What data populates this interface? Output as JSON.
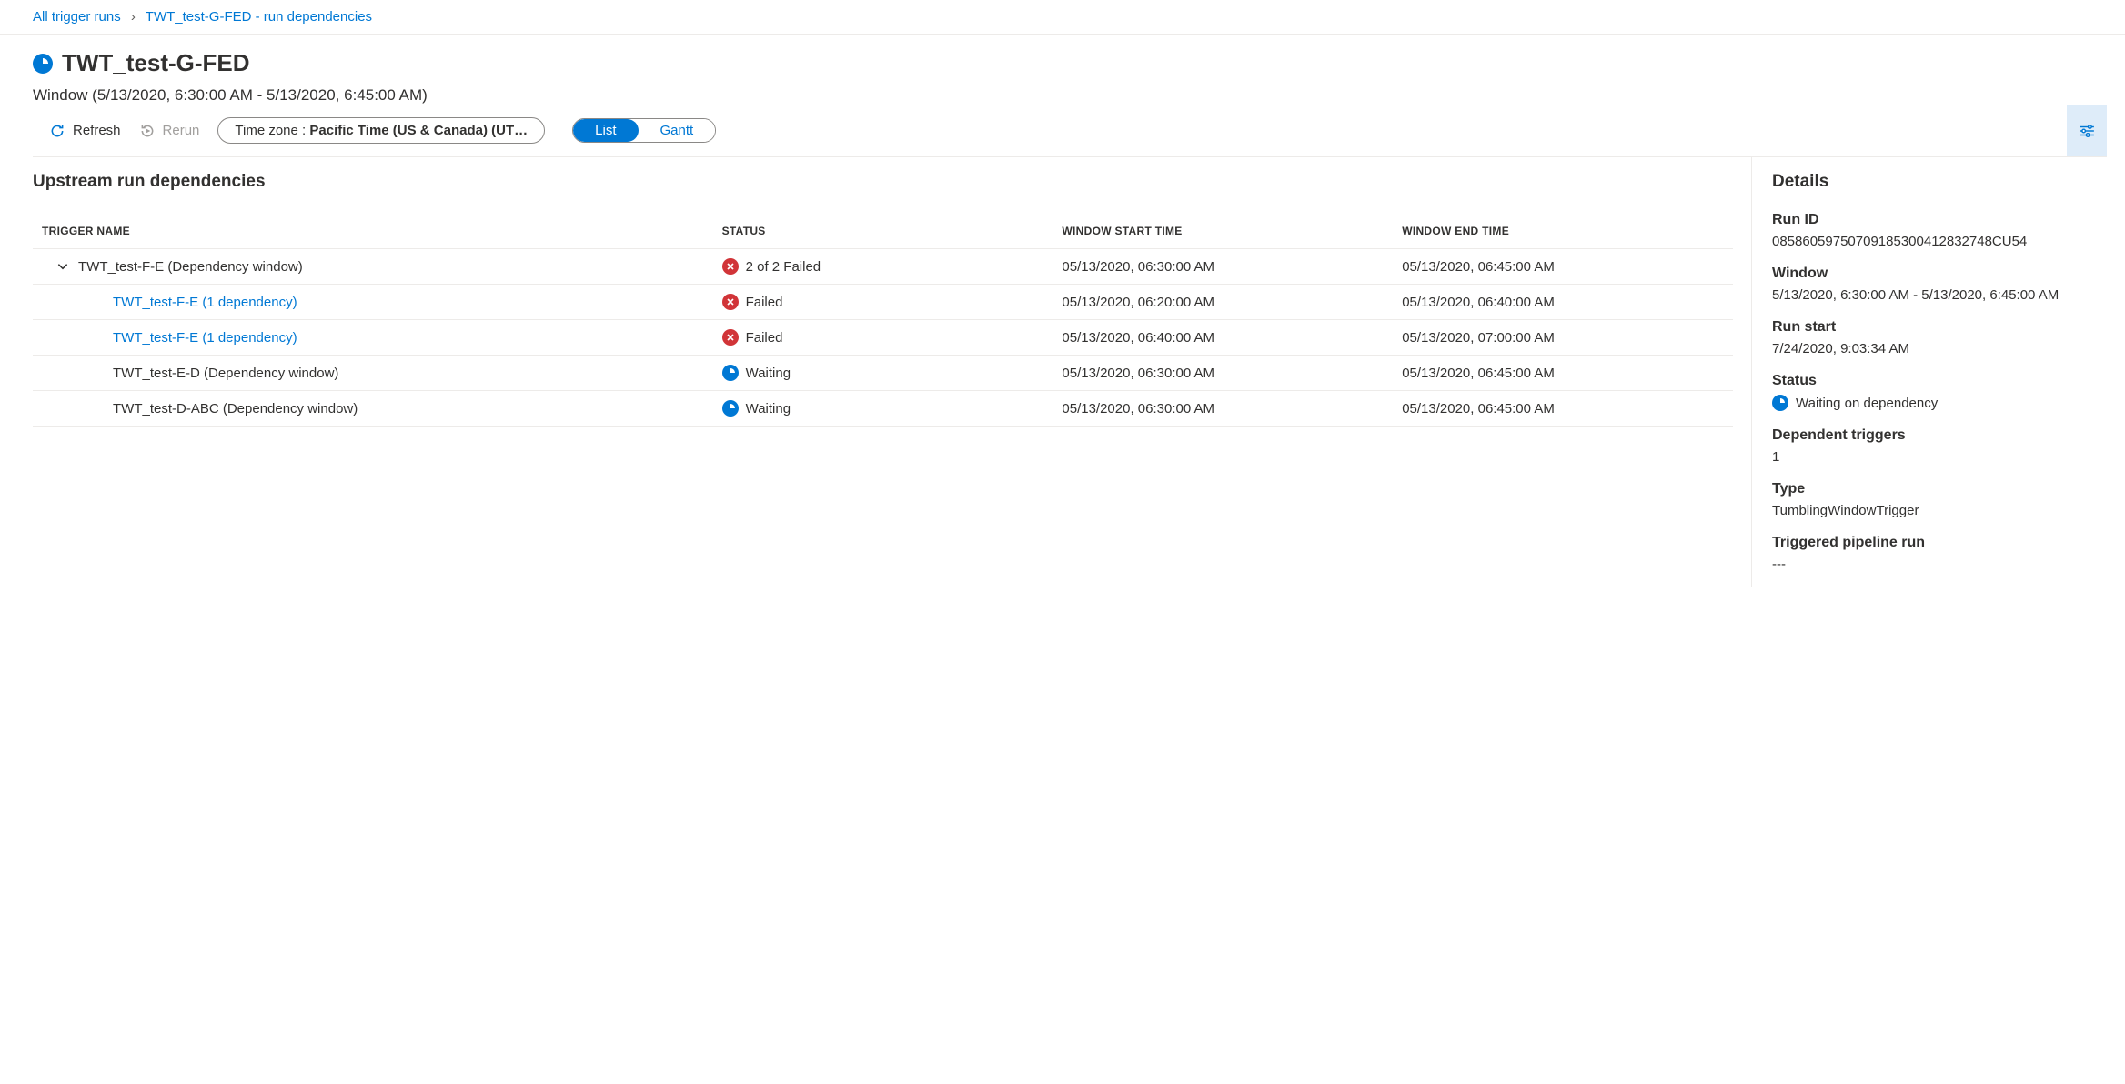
{
  "breadcrumb": {
    "root": "All trigger runs",
    "current": "TWT_test-G-FED - run dependencies"
  },
  "header": {
    "title": "TWT_test-G-FED",
    "window": "Window (5/13/2020, 6:30:00 AM - 5/13/2020, 6:45:00 AM)"
  },
  "toolbar": {
    "refresh": "Refresh",
    "rerun": "Rerun",
    "timezone_label": "Time zone : ",
    "timezone_value": "Pacific Time (US & Canada) (UT…",
    "view_list": "List",
    "view_gantt": "Gantt"
  },
  "section_title": "Upstream run dependencies",
  "columns": {
    "trigger": "TRIGGER NAME",
    "status": "STATUS",
    "start": "WINDOW START TIME",
    "end": "WINDOW END TIME"
  },
  "rows": [
    {
      "indent": 1,
      "chevron": true,
      "name": "TWT_test-F-E (Dependency window)",
      "link": false,
      "status": "2 of 2 Failed",
      "status_type": "failed",
      "start": "05/13/2020, 06:30:00 AM",
      "end": "05/13/2020, 06:45:00 AM"
    },
    {
      "indent": 2,
      "chevron": false,
      "name": "TWT_test-F-E (1 dependency)",
      "link": true,
      "status": "Failed",
      "status_type": "failed",
      "start": "05/13/2020, 06:20:00 AM",
      "end": "05/13/2020, 06:40:00 AM"
    },
    {
      "indent": 2,
      "chevron": false,
      "name": "TWT_test-F-E (1 dependency)",
      "link": true,
      "status": "Failed",
      "status_type": "failed",
      "start": "05/13/2020, 06:40:00 AM",
      "end": "05/13/2020, 07:00:00 AM"
    },
    {
      "indent": 2,
      "chevron": false,
      "name": "TWT_test-E-D (Dependency window)",
      "link": false,
      "status": "Waiting",
      "status_type": "waiting",
      "start": "05/13/2020, 06:30:00 AM",
      "end": "05/13/2020, 06:45:00 AM"
    },
    {
      "indent": 2,
      "chevron": false,
      "name": "TWT_test-D-ABC (Dependency window)",
      "link": false,
      "status": "Waiting",
      "status_type": "waiting",
      "start": "05/13/2020, 06:30:00 AM",
      "end": "05/13/2020, 06:45:00 AM"
    }
  ],
  "details": {
    "heading": "Details",
    "labels": {
      "run_id": "Run ID",
      "window": "Window",
      "run_start": "Run start",
      "status": "Status",
      "dependent_triggers": "Dependent triggers",
      "type": "Type",
      "pipeline_run": "Triggered pipeline run"
    },
    "values": {
      "run_id": "08586059750709185300412832748CU54",
      "window": "5/13/2020, 6:30:00 AM - 5/13/2020, 6:45:00 AM",
      "run_start": "7/24/2020, 9:03:34 AM",
      "status": "Waiting on dependency",
      "dependent_triggers": "1",
      "type": "TumblingWindowTrigger",
      "pipeline_run": "---"
    }
  }
}
